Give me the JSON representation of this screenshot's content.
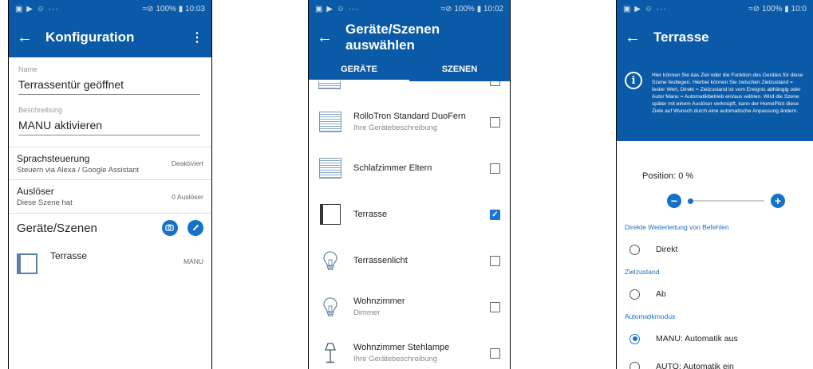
{
  "panel1": {
    "status": {
      "icons": "▣ ▶ ☺ ···",
      "right": "≈⊘ 100% ▮ 10:03"
    },
    "title": "Konfiguration",
    "menu_icon": "⋮",
    "name_label": "Name",
    "name_value": "Terrassentür geöffnet",
    "desc_label": "Beschreibung",
    "desc_value": "MANU aktivieren",
    "voice": {
      "title": "Sprachsteuerung",
      "sub": "Steuern via Alexa / Google Assistant",
      "right": "Deaktiviert"
    },
    "trigger": {
      "title": "Auslöser",
      "sub": "Diese Szene hat",
      "right": "0 Auslöser"
    },
    "section_title": "Geräte/Szenen",
    "device": {
      "name": "Terrasse",
      "mode": "MANU"
    }
  },
  "panel2": {
    "status": {
      "icons": "▣ ▶ ☺ ···",
      "right": "≈⊘ 100% ▮ 10:02"
    },
    "title": "Geräte/Szenen auswählen",
    "tabs": [
      "GERÄTE",
      "SZENEN"
    ],
    "items": [
      {
        "name": "RolloTron Standard DuoFern",
        "desc": "Ihre Gerätebeschreibung",
        "icon": "shutter-icon",
        "checked": false
      },
      {
        "name": "Schlafzimmer Eltern",
        "desc": "",
        "icon": "shutter-icon",
        "checked": false
      },
      {
        "name": "Terrasse",
        "desc": "",
        "icon": "window-icon",
        "checked": true
      },
      {
        "name": "Terrassenlicht",
        "desc": "",
        "icon": "bulb-icon",
        "checked": false
      },
      {
        "name": "Wohnzimmer",
        "desc": "Dimmer",
        "icon": "bulb-icon",
        "checked": false
      },
      {
        "name": "Wohnzimmer Stehlampe",
        "desc": "Ihre Gerätebeschreibung",
        "icon": "floor-lamp-icon",
        "checked": false
      }
    ]
  },
  "panel3": {
    "status": {
      "icons": "▣ ▶ ☺ ···",
      "right": "≈⊘ 100% ▮ 10:0"
    },
    "title": "Terrasse",
    "info": "Hier können Sie das Ziel oder die Funktion des Gerätes für diese Szene festlegen. Hierbei können Sie zwischen Zielzustand = fester Wert, Direkt = Zielzustand ist vom Ereignis abhängig oder Auto/ Manu = Automatikbetrieb ein/aus wählen. Wird die Szene später mit einem Auslöser verknüpft, kann der HomePilot diese Ziele auf Wunsch durch eine automatische Anpassung ändern.",
    "position_label": "Position: 0 %",
    "position_value": 0,
    "headers": [
      "Direkte Weiterleitung von Befehlen",
      "Zielzustand",
      "Automatikmodus"
    ],
    "options": {
      "direkt": "Direkt",
      "ab": "Ab",
      "manu": "MANU: Automatik aus",
      "auto": "AUTO: Automatik ein"
    },
    "selected": "manu"
  }
}
